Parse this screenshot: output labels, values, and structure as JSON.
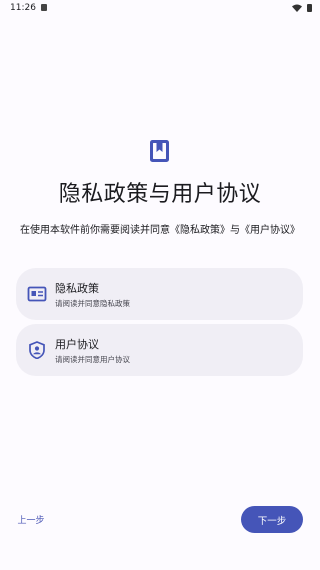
{
  "status_bar": {
    "time": "11:26"
  },
  "header": {
    "icon": "book-bookmark-icon",
    "title": "隐私政策与用户协议",
    "subtitle": "在使用本软件前你需要阅读并同意《隐私政策》与《用户协议》"
  },
  "cards": [
    {
      "icon": "id-card-icon",
      "title": "隐私政策",
      "description": "请阅读并同意隐私政策"
    },
    {
      "icon": "shield-user-icon",
      "title": "用户协议",
      "description": "请阅读并同意用户协议"
    }
  ],
  "footer": {
    "prev_label": "上一步",
    "next_label": "下一步"
  },
  "colors": {
    "accent": "#4555b8",
    "card_bg": "#f0eef5",
    "background": "#fdfbff"
  }
}
